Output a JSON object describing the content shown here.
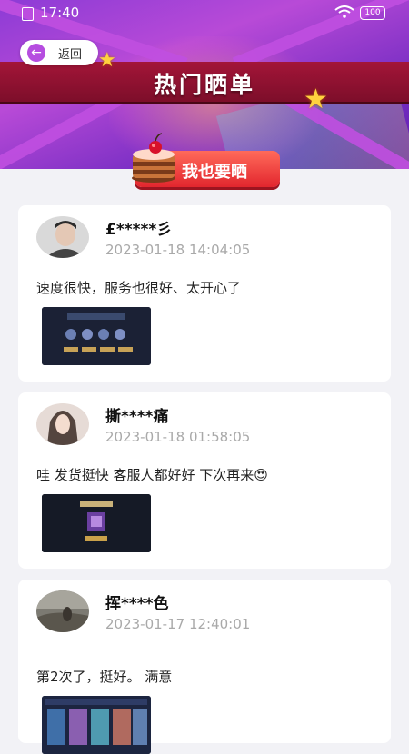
{
  "status_bar": {
    "time": "17:40",
    "battery": "100"
  },
  "header": {
    "back_label": "返回",
    "title": "热门晒单",
    "post_button_label": "我也要晒"
  },
  "feed": [
    {
      "username": "£*****彡",
      "date": "2023-01-18 14:04:05",
      "comment": "速度很快，服务也很好、太开心了"
    },
    {
      "username": "撕****痛",
      "date": "2023-01-18 01:58:05",
      "comment": "哇 发货挺快 客服人都好好 下次再来😍"
    },
    {
      "username": "挥****色",
      "date": "2023-01-17 12:40:01",
      "comment": "第2次了，挺好。 满意"
    }
  ],
  "colors": {
    "banner_purple": "#b84ad7",
    "ribbon_red": "#a31538",
    "button_red": "#e2262e",
    "date_gray": "#a9a9a9"
  }
}
